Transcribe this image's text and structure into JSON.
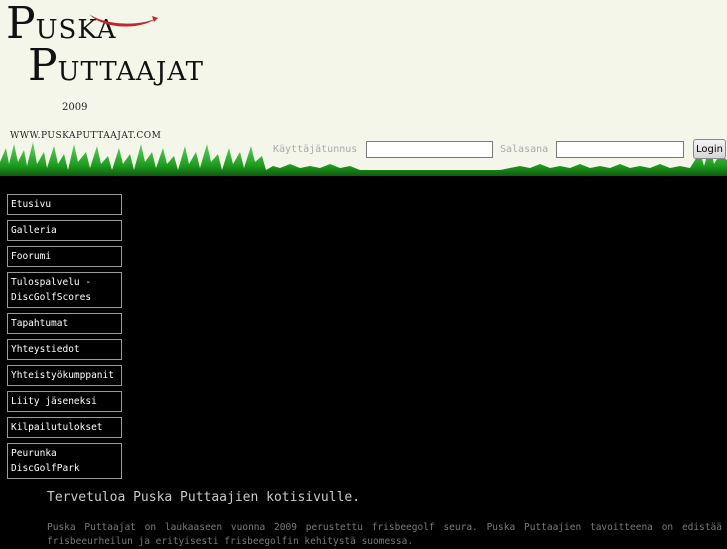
{
  "logo": {
    "line1_initial": "P",
    "line1_rest": "USKA",
    "line2_initial": "P",
    "line2_rest": "UTTAAJAT",
    "year": "2009",
    "url": "WWW.PUSKAPUTTAAJAT.COM"
  },
  "login": {
    "username_label": "Käyttäjätunnus",
    "password_label": "Salasana",
    "button_label": "Login",
    "username_value": "",
    "password_value": ""
  },
  "nav": {
    "items": [
      {
        "label": "Etusivu"
      },
      {
        "label": "Galleria"
      },
      {
        "label": "Foorumi"
      },
      {
        "label": "Tulospalvelu - DiscGolfScores"
      },
      {
        "label": "Tapahtumat"
      },
      {
        "label": "Yhteystiedot"
      },
      {
        "label": "Yhteistyökumppanit"
      },
      {
        "label": "Liity jäseneksi"
      },
      {
        "label": "Kilpailutulokset"
      },
      {
        "label": "Peurunka DiscGolfPark"
      }
    ]
  },
  "content": {
    "title": "Tervetuloa Puska Puttaajien kotisivulle.",
    "text": "Puska Puttaajat on laukaaseen vuonna 2009 perustettu frisbeegolf seura. Puska Puttaajien tavoitteena on edistää frisbeeurheilun ja erityisesti frisbeegolfin kehitystä suomessa."
  },
  "colors": {
    "header_bg": "#f4f6ea",
    "grass": "#1c9a1c",
    "page_bg": "#000000",
    "swoosh": "#c0282b"
  }
}
